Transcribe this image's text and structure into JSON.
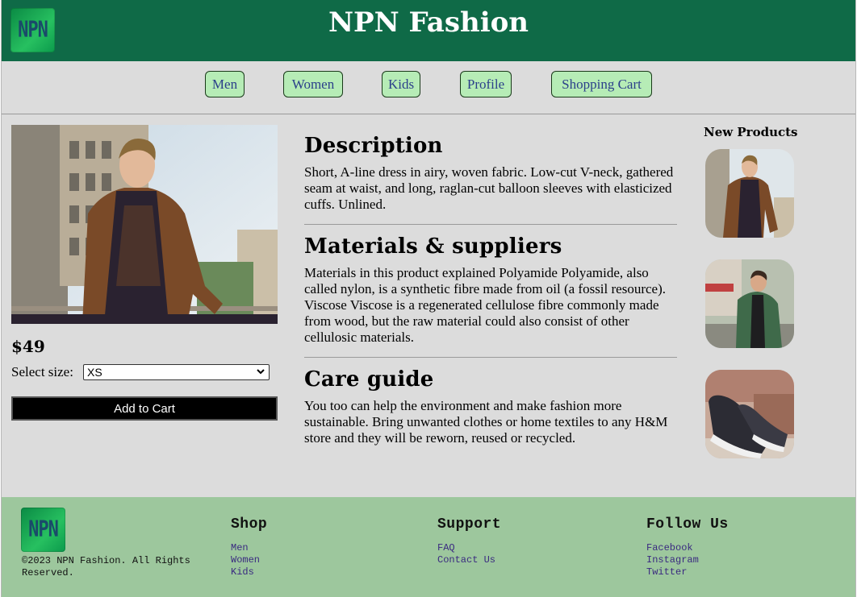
{
  "header": {
    "logo_text": "NPN",
    "title": "NPN Fashion"
  },
  "nav": {
    "items": [
      "Men",
      "Women",
      "Kids",
      "Profile",
      "Shopping Cart"
    ]
  },
  "product": {
    "price": "$49",
    "size_label": "Select size:",
    "size_selected": "XS",
    "add_to_cart": "Add to Cart"
  },
  "sections": [
    {
      "title": "Description",
      "text": "Short, A-line dress in airy, woven fabric. Low-cut V-neck, gathered seam at waist, and long, raglan-cut balloon sleeves with elasticized cuffs. Unlined."
    },
    {
      "title": "Materials & suppliers",
      "text": "Materials in this product explained Polyamide Polyamide, also called nylon, is a synthetic fibre made from oil (a fossil resource). Viscose Viscose is a regenerated cellulose fibre commonly made from wood, but the raw material could also consist of other cellulosic materials."
    },
    {
      "title": "Care guide",
      "text": "You too can help the environment and make fashion more sustainable. Bring unwanted clothes or home textiles to any H&M store and they will be reworn, reused or recycled."
    }
  ],
  "new_products": {
    "title": "New Products"
  },
  "footer": {
    "logo_text": "NPN",
    "copyright": "©2023 NPN Fashion. All Rights Reserved.",
    "shop": {
      "title": "Shop",
      "links": [
        "Men",
        "Women",
        "Kids"
      ]
    },
    "support": {
      "title": "Support",
      "links": [
        "FAQ",
        "Contact Us"
      ]
    },
    "follow": {
      "title": "Follow Us",
      "links": [
        "Facebook",
        "Instagram",
        "Twitter"
      ]
    }
  },
  "colors": {
    "header_bg": "#0f6a47",
    "nav_button_bg": "#b6ecb6",
    "footer_bg": "#9dc79d",
    "page_bg": "#dcdcdc"
  }
}
